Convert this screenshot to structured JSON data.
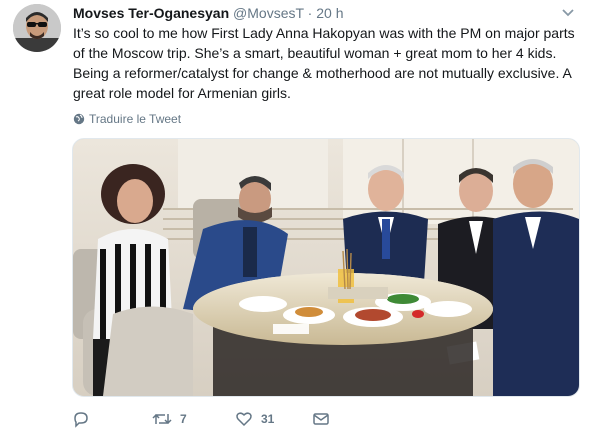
{
  "tweet": {
    "author_name": "Movses Ter-Oganesyan",
    "handle": "@MovsesT",
    "separator": "·",
    "time": "20 h",
    "text_lines": [
      "It’s so cool to me how First Lady Anna Hakopyan was with the PM on major parts",
      "of the Moscow trip. She’s a smart, beautiful woman + great mom to her 4 kids.",
      "Being a reformer/catalyst for change & motherhood are not mutually exclusive. A",
      "great role model for Armenian girls."
    ],
    "translate_label": "Traduire le Tweet"
  },
  "actions": {
    "reply_count": "",
    "retweet_count": "7",
    "like_count": "31"
  },
  "icons": {
    "avatar": "avatar",
    "caret": "chevron-down-icon",
    "translate": "globe-icon",
    "reply": "reply-icon",
    "retweet": "retweet-icon",
    "like": "heart-icon",
    "message": "envelope-icon"
  },
  "colors": {
    "text": "#14171a",
    "secondary": "#657786",
    "border": "#e1e8ed"
  }
}
